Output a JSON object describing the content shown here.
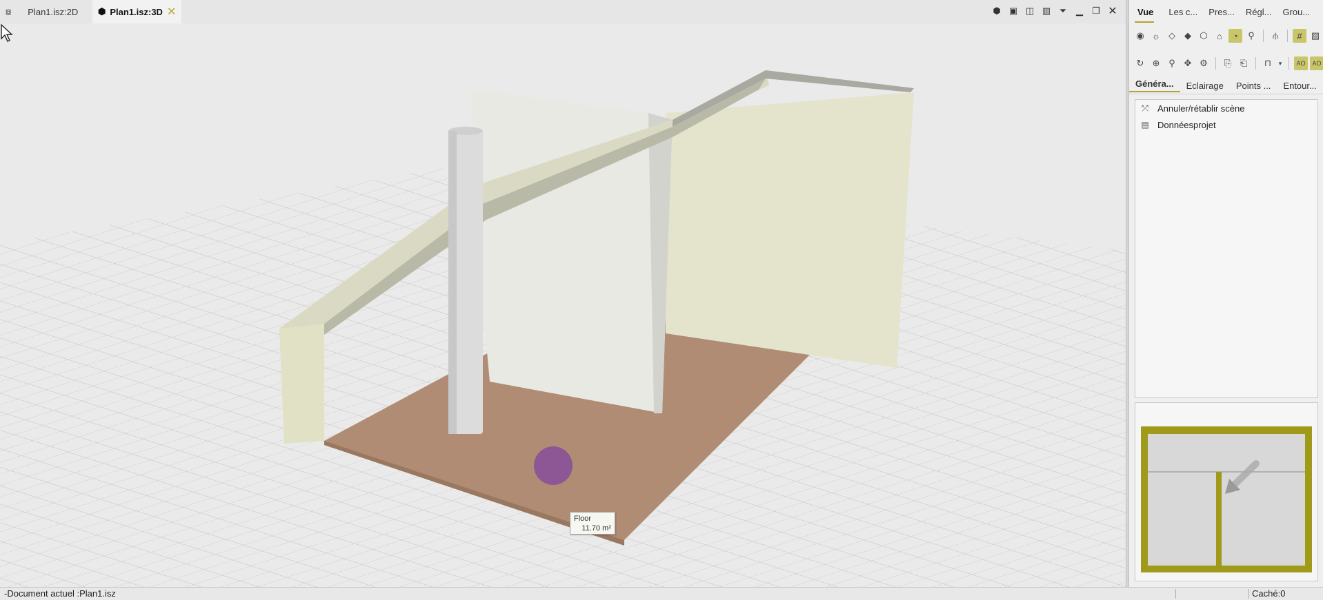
{
  "tabs": [
    {
      "label": "Plan1.isz:2D",
      "active": false,
      "icon": "plan-2d-icon"
    },
    {
      "label": "Plan1.isz:3D",
      "active": true,
      "icon": "cube-3d-icon"
    }
  ],
  "window_icons": [
    "view-cube-icon",
    "frame-icon",
    "fit-width-icon",
    "columns-icon",
    "filter-icon",
    "minimize-icon",
    "restore-icon",
    "close-icon"
  ],
  "right_panel": {
    "tabs": [
      "Vue",
      "Les c...",
      "Pres...",
      "Régl...",
      "Grou..."
    ],
    "active_tab": "Vue",
    "subtabs": [
      "Généra...",
      "Eclairage",
      "Points ...",
      "Entour..."
    ],
    "active_subtab": "Généra...",
    "list_items": [
      {
        "label": "Annuler/rétablir scène",
        "icon": "undo-scene-icon"
      },
      {
        "label": "Donnéesprojet",
        "icon": "project-data-icon"
      }
    ]
  },
  "viewport": {
    "tooltip_title": "Floor",
    "tooltip_value": "11.70 m²"
  },
  "status": {
    "document": "-Document actuel :Plan1.isz",
    "cache": "Caché:0"
  },
  "colors": {
    "accent": "#b5a236",
    "minimap_frame": "#a09a1a",
    "floor": "#b08c74",
    "wall": "#e6e6d6",
    "roof": "#c9c9b7",
    "cursor_halo": "#8a4aa8"
  }
}
